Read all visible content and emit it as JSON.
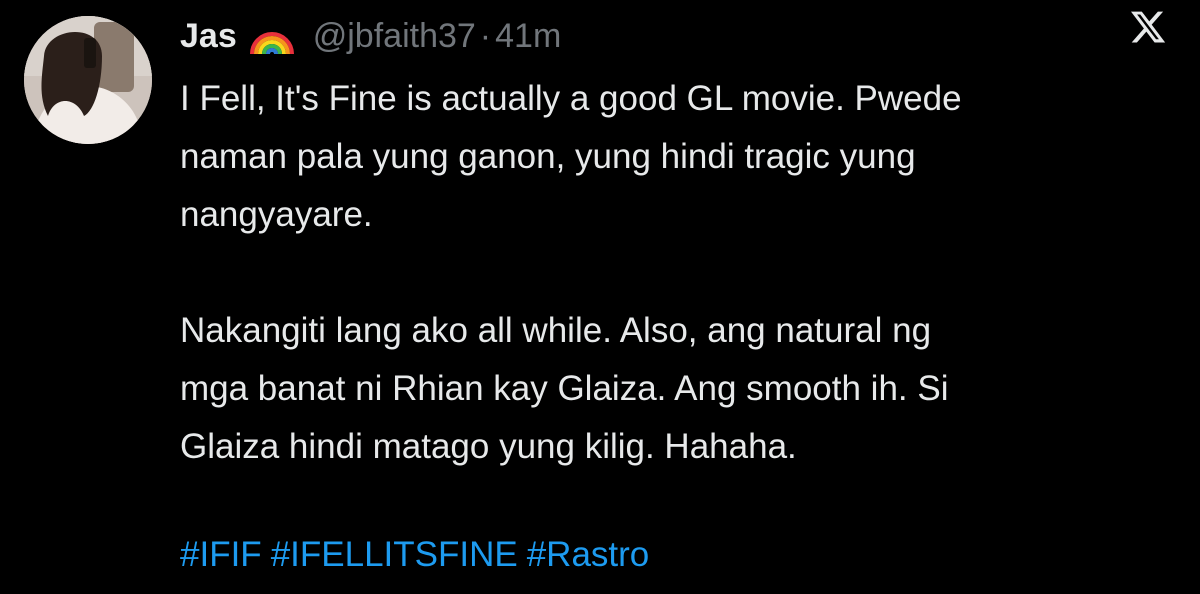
{
  "author": {
    "name": "Jas",
    "emoji": "rainbow-emoji",
    "handle": "@jbfaith37",
    "separator": "·",
    "time": "41m"
  },
  "brand_icon": "x-logo-icon",
  "tweet": {
    "lines_p1": [
      "I Fell, It's Fine is actually a good GL movie. Pwede",
      "naman pala yung ganon, yung hindi tragic yung",
      "nangyayare."
    ],
    "lines_p2": [
      "Nakangiti lang ako all while. Also, ang natural ng",
      "mga banat ni Rhian kay Glaiza. Ang smooth ih. Si",
      "Glaiza hindi matago yung kilig. Hahaha."
    ],
    "hashtags": [
      "#IFIF",
      "#IFELLITSFINE",
      "#Rastro"
    ]
  },
  "colors": {
    "background": "#000000",
    "text": "#e7e9ea",
    "muted": "#71767b",
    "link": "#1d9bf0"
  }
}
